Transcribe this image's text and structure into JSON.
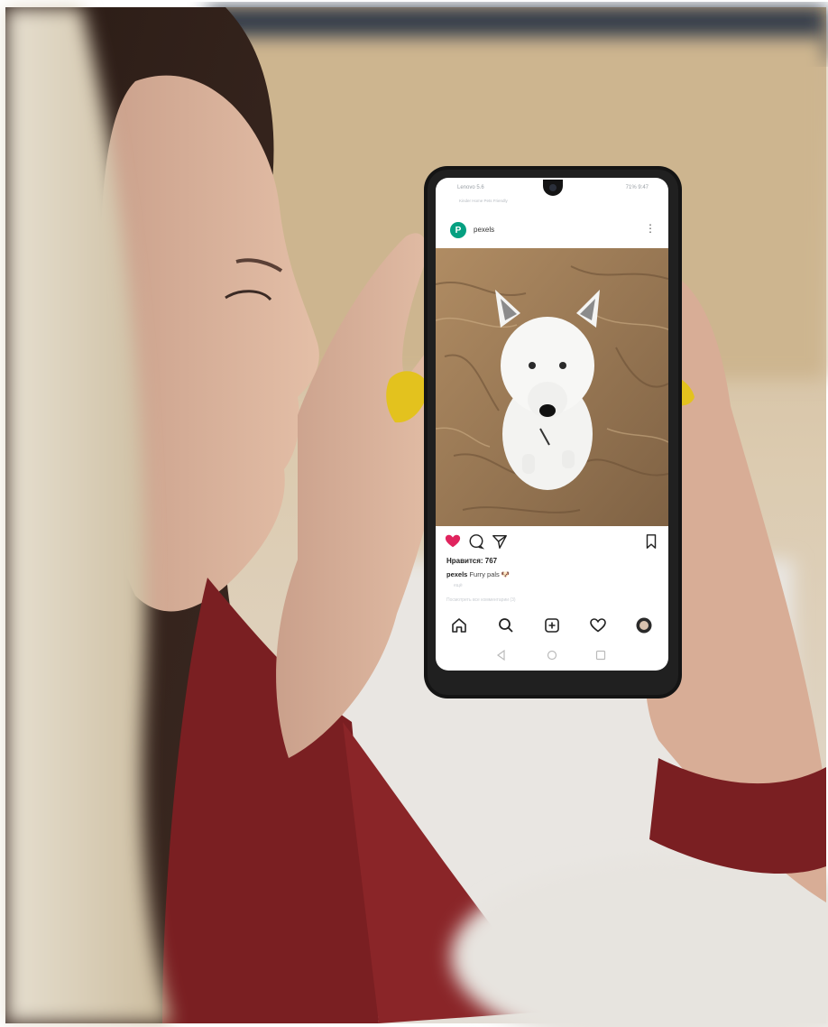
{
  "phone": {
    "status_left": "Lenovo 5.6",
    "status_right": "71% 9:47",
    "status_sub": "Kinder Home Pets Friendly",
    "account_name": "pexels",
    "logo_letter": "P",
    "likes": "Нравится: 767",
    "caption_user": "pexels",
    "caption_text": "Furry pals 🐶",
    "more_text": "ещё",
    "comments_link": "Посмотреть все комментарии (3)"
  },
  "icons": [
    "heart-icon",
    "comment-icon",
    "share-icon",
    "bookmark-icon",
    "home-icon",
    "search-icon",
    "add-post-icon",
    "activity-icon",
    "profile-avatar"
  ],
  "colors": {
    "like_red": "#e0245e",
    "logo_green": "#05a081",
    "nail_yellow": "#e3c21e",
    "sweater_red": "#7a1f22",
    "sand": "#a07d55"
  }
}
